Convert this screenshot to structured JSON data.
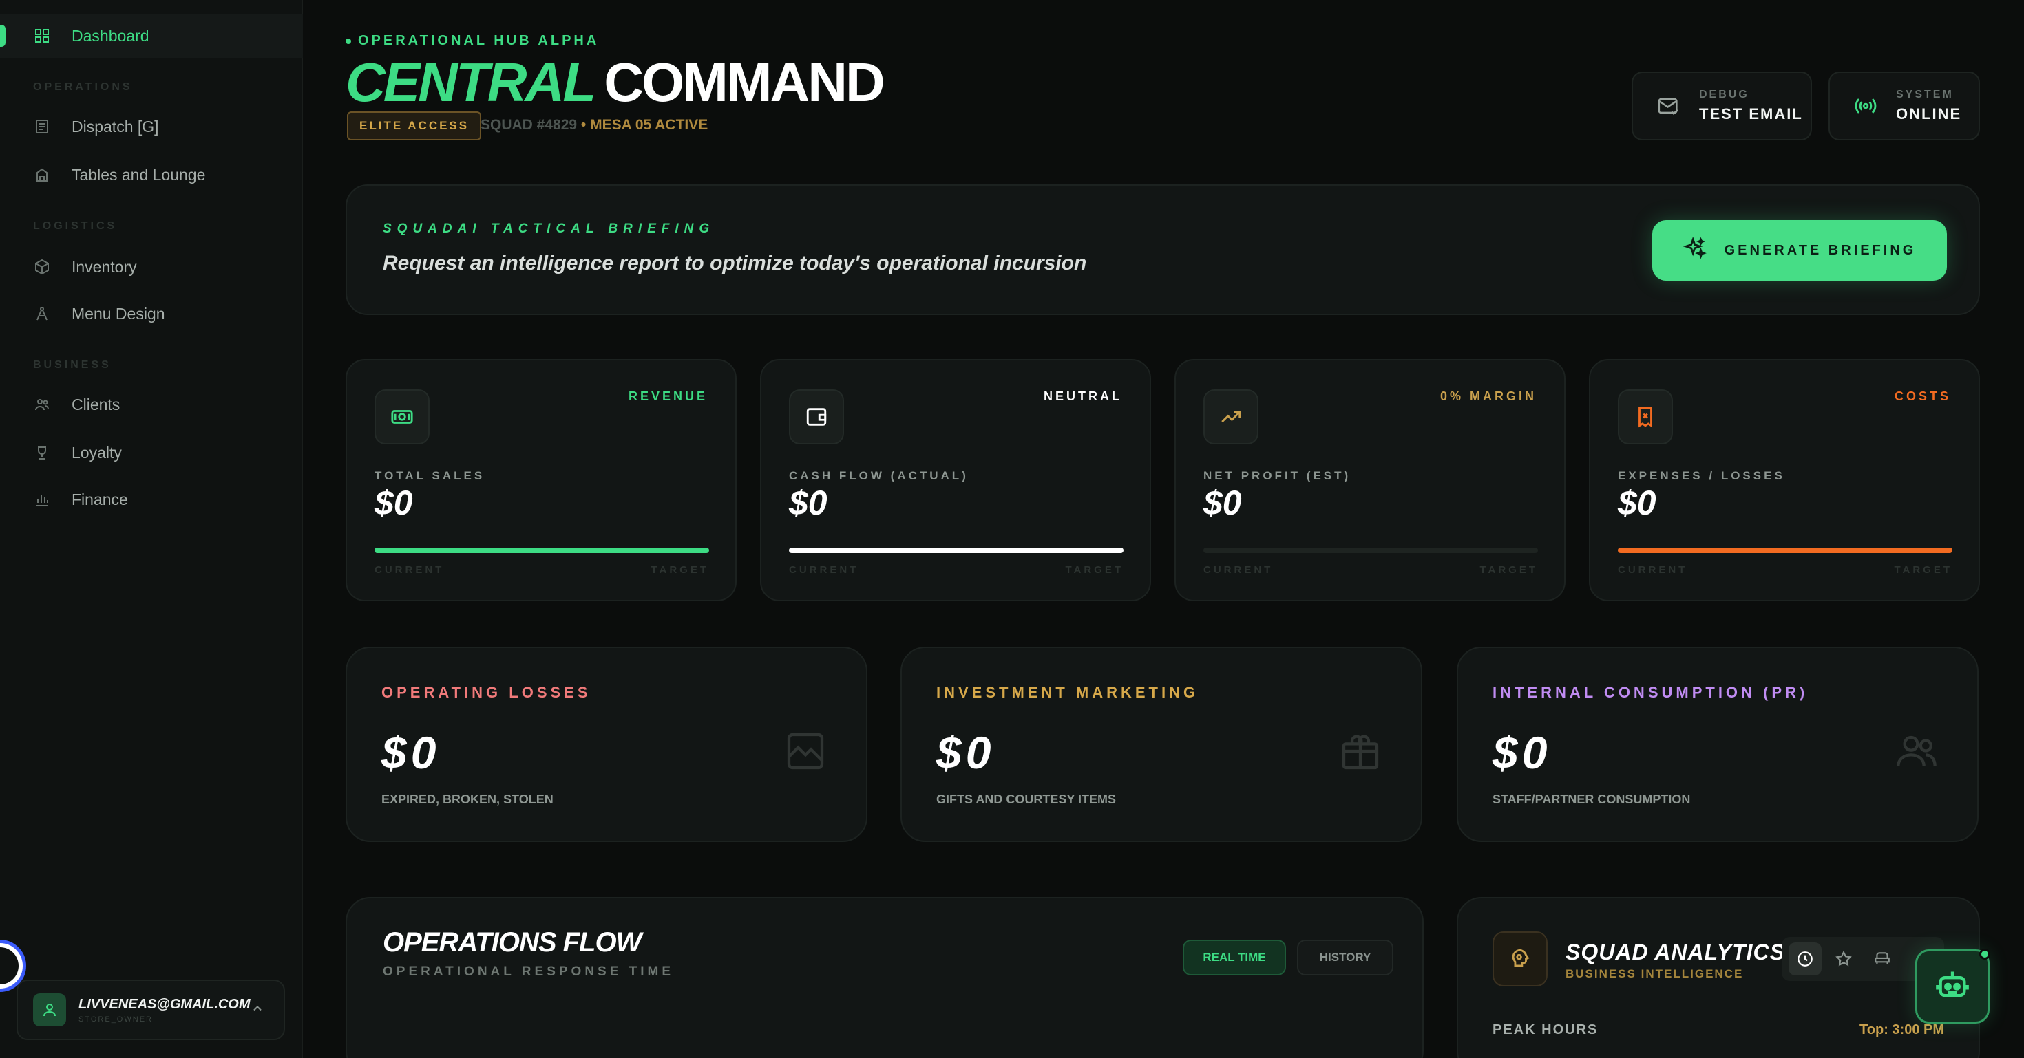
{
  "sidebar": {
    "active": "Dashboard",
    "sections": {
      "operations": "OPERATIONS",
      "logistics": "LOGISTICS",
      "business": "BUSINESS"
    },
    "items": {
      "dispatch": "Dispatch [G]",
      "tables": "Tables and Lounge",
      "inventory": "Inventory",
      "menu": "Menu Design",
      "clients": "Clients",
      "loyalty": "Loyalty",
      "finance": "Finance"
    },
    "user": {
      "email": "LIVVENEAS@GMAIL.COM",
      "role": "STORE_OWNER"
    }
  },
  "header": {
    "hub": "OPERATIONAL HUB ALPHA",
    "title_part1": "CENTRAL",
    "title_part2": "COMMAND",
    "access": "ELITE ACCESS",
    "squad": "SQUAD #4829",
    "mesa": "MESA 05 ACTIVE",
    "debug_sub": "DEBUG",
    "debug_main": "TEST EMAIL",
    "system_sub": "SYSTEM",
    "system_main": "ONLINE"
  },
  "briefing": {
    "label": "SQUADAI TACTICAL BRIEFING",
    "text": "Request an intelligence report to optimize today's operational incursion",
    "button": "GENERATE BRIEFING"
  },
  "stats": [
    {
      "tag": "REVENUE",
      "label": "TOTAL SALES",
      "value": "$0",
      "fill": 1.0,
      "left": "CURRENT",
      "right": "TARGET"
    },
    {
      "tag": "NEUTRAL",
      "label": "CASH FLOW (ACTUAL)",
      "value": "$0",
      "fill": 1.0,
      "left": "CURRENT",
      "right": "TARGET"
    },
    {
      "tag": "0% MARGIN",
      "label": "NET PROFIT (EST)",
      "value": "$0",
      "fill": 0.0,
      "left": "CURRENT",
      "right": "TARGET"
    },
    {
      "tag": "COSTS",
      "label": "EXPENSES / LOSSES",
      "value": "$0",
      "fill": 1.0,
      "left": "CURRENT",
      "right": "TARGET"
    }
  ],
  "losses": [
    {
      "label": "OPERATING LOSSES",
      "value": "$0",
      "sub": "EXPIRED, BROKEN, STOLEN"
    },
    {
      "label": "INVESTMENT MARKETING",
      "value": "$0",
      "sub": "GIFTS AND COURTESY ITEMS"
    },
    {
      "label": "INTERNAL CONSUMPTION (PR)",
      "value": "$0",
      "sub": "STAFF/PARTNER CONSUMPTION"
    }
  ],
  "ops": {
    "title": "OPERATIONS FLOW",
    "sub": "OPERATIONAL RESPONSE TIME",
    "realtime": "REAL TIME",
    "history": "HISTORY"
  },
  "squad": {
    "title": "SQUAD ANALYTICS",
    "sub": "BUSINESS INTELLIGENCE",
    "peak": "PEAK HOURS",
    "top": "Top: 3:00 PM"
  },
  "colors": {
    "accent": "#3ddc84",
    "amber": "#c9a04d",
    "orange": "#f26b21",
    "red": "#f06b6b",
    "purple": "#c08cf2"
  }
}
